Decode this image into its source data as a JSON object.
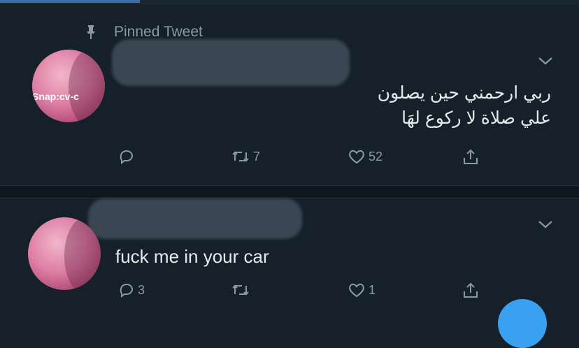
{
  "pinned_label": "Pinned Tweet",
  "tweets": [
    {
      "avatar_label": "Snap:cv-c",
      "text_lines": [
        "ربي ارحمني حين يصلون",
        "علي صلاة لا ركوع لهَا"
      ],
      "actions": {
        "reply": "",
        "retweet": "7",
        "like": "52",
        "share": ""
      }
    },
    {
      "text": "fuck me in your car",
      "actions": {
        "reply": "3",
        "retweet": "",
        "like": "1",
        "share": ""
      }
    }
  ],
  "icons": [
    "pin-icon",
    "chevron-down-icon",
    "reply-icon",
    "retweet-icon",
    "like-icon",
    "share-icon"
  ],
  "colors": {
    "background": "#15202b",
    "muted": "#8b98a5",
    "text": "#e6e9ec",
    "accent": "#3aa0f0"
  }
}
